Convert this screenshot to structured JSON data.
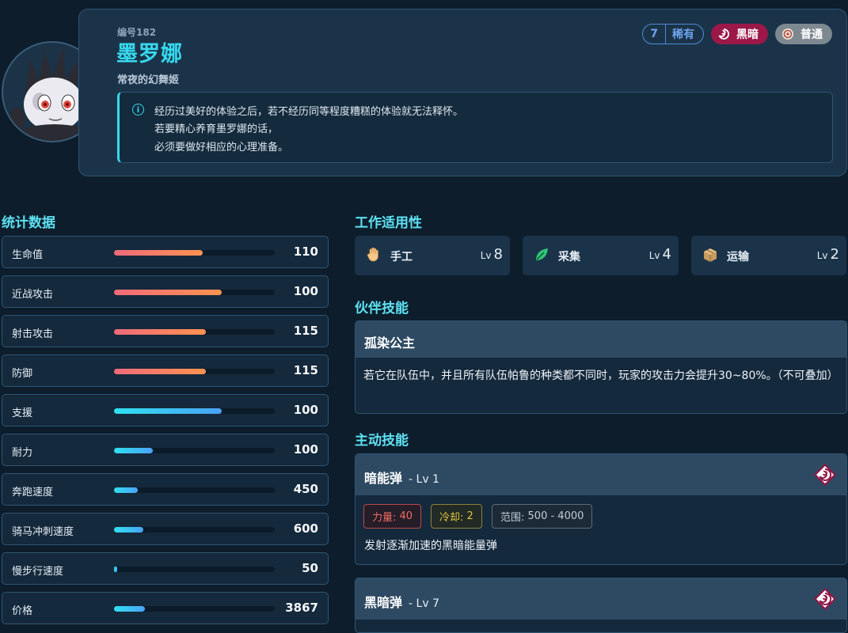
{
  "header": {
    "number": "编号182",
    "name": "墨罗娜",
    "title": "常夜的幻舞姬",
    "rarity": {
      "value": "7",
      "label": "稀有"
    },
    "elements": [
      {
        "label": "黑暗",
        "icon": "dark-element-icon",
        "color": "#9b1848"
      },
      {
        "label": "普通",
        "icon": "neutral-element-icon",
        "color": "#7d8890"
      }
    ],
    "description": [
      "经历过美好的体验之后，若不经历同等程度糟糕的体验就无法释怀。",
      "若要精心养育墨罗娜的话，",
      "必须要做好相应的心理准备。"
    ]
  },
  "stats": {
    "title": "统计数据",
    "items": [
      {
        "label": "生命值",
        "value": "110",
        "fill": 0.55,
        "color": "red"
      },
      {
        "label": "近战攻击",
        "value": "100",
        "fill": 0.67,
        "color": "red"
      },
      {
        "label": "射击攻击",
        "value": "115",
        "fill": 0.57,
        "color": "red"
      },
      {
        "label": "防御",
        "value": "115",
        "fill": 0.57,
        "color": "red"
      },
      {
        "label": "支援",
        "value": "100",
        "fill": 0.67,
        "color": "blue"
      },
      {
        "label": "耐力",
        "value": "100",
        "fill": 0.24,
        "color": "blue"
      },
      {
        "label": "奔跑速度",
        "value": "450",
        "fill": 0.15,
        "color": "blue"
      },
      {
        "label": "骑马冲刺速度",
        "value": "600",
        "fill": 0.18,
        "color": "blue"
      },
      {
        "label": "慢步行速度",
        "value": "50",
        "fill": 0.02,
        "color": "blue"
      },
      {
        "label": "价格",
        "value": "3867",
        "fill": 0.19,
        "color": "blue"
      }
    ]
  },
  "work": {
    "title": "工作适用性",
    "items": [
      {
        "label": "手工",
        "lv_prefix": "Lv",
        "level": "8",
        "icon": "handiwork-icon"
      },
      {
        "label": "采集",
        "lv_prefix": "Lv",
        "level": "4",
        "icon": "gathering-icon"
      },
      {
        "label": "运输",
        "lv_prefix": "Lv",
        "level": "2",
        "icon": "transporting-icon"
      }
    ]
  },
  "partner_skill": {
    "title": "伙伴技能",
    "name": "孤染公主",
    "description": "若它在队伍中，并且所有队伍帕鲁的种类都不同时，玩家的攻击力会提升30~80%。（不可叠加）"
  },
  "active_skills": {
    "title": "主动技能",
    "items": [
      {
        "name": "暗能弹",
        "level": "- Lv 1",
        "power_label": "力量:",
        "power": "40",
        "cooldown_label": "冷却:",
        "cooldown": "2",
        "range_label": "范围:",
        "range": "500 - 4000",
        "description": "发射逐渐加速的黑暗能量弹"
      },
      {
        "name": "黑暗弹",
        "level": "- Lv 7"
      }
    ]
  }
}
